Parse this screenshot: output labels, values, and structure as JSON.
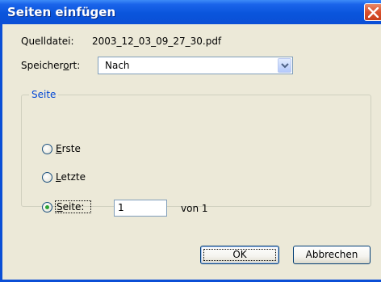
{
  "window": {
    "title": "Seiten einfügen"
  },
  "source": {
    "label": "Quelldatei:",
    "value": "2003_12_03_09_27_30.pdf"
  },
  "location": {
    "label_pre": "Speicher",
    "label_mnemonic": "o",
    "label_post": "rt:",
    "selected": "Nach"
  },
  "pages_group": {
    "title": "Seite",
    "first": {
      "mnemonic": "E",
      "rest": "rste",
      "selected": false
    },
    "last": {
      "mnemonic": "L",
      "rest": "etzte",
      "selected": false
    },
    "page": {
      "mnemonic": "S",
      "rest": "eite:",
      "selected": true,
      "value": "1",
      "of_text": "von 1"
    }
  },
  "buttons": {
    "ok": "OK",
    "cancel": "Abbrechen"
  },
  "colors": {
    "title_bar": "#0b4fd6",
    "dialog_face": "#ece9d8",
    "group_title": "#0046d5",
    "close_button": "#d9502d",
    "radio_dot": "#2ca434"
  },
  "icons": {
    "close": "close-icon",
    "dropdown": "chevron-down-icon"
  }
}
